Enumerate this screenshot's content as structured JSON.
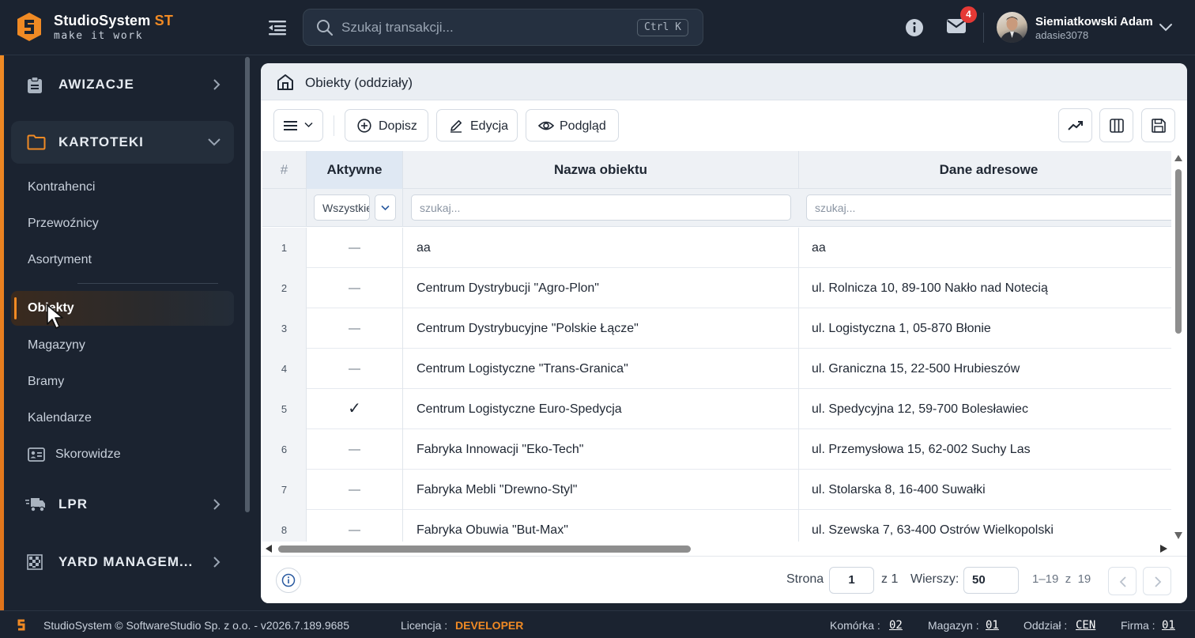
{
  "app": {
    "name": "StudioSystem",
    "name_suffix": "ST",
    "tagline": "make it work",
    "brand_color": "#f08a24"
  },
  "header": {
    "search_placeholder": "Szukaj transakcji...",
    "search_shortcut": "Ctrl K",
    "notifications_count": "4",
    "user_name": "Siemiatkowski Adam",
    "user_login": "adasie3078"
  },
  "sidebar": {
    "sections": [
      {
        "label": "AWIZACJE",
        "icon": "clipboard-icon",
        "expanded": false
      },
      {
        "label": "KARTOTEKI",
        "icon": "folder-icon",
        "expanded": true
      },
      {
        "label": "LPR",
        "icon": "truck-icon",
        "expanded": false
      },
      {
        "label": "YARD MANAGEM...",
        "icon": "grid-pattern-icon",
        "expanded": false
      }
    ],
    "items": [
      "Kontrahenci",
      "Przewoźnicy",
      "Asortyment",
      "Obiekty",
      "Magazyny",
      "Bramy",
      "Kalendarze",
      "Skorowidze"
    ],
    "active_item": "Obiekty"
  },
  "page": {
    "title": "Obiekty (oddziały)"
  },
  "toolbar": {
    "add_label": "Dopisz",
    "edit_label": "Edycja",
    "preview_label": "Podgląd"
  },
  "grid": {
    "col_index": "#",
    "col_active": "Aktywne",
    "col_name": "Nazwa obiektu",
    "col_address": "Dane adresowe",
    "filter_active_value": "Wszystkie",
    "filter_placeholder": "szukaj...",
    "rows": [
      {
        "n": "1",
        "active": "—",
        "name": "aa",
        "address": "aa"
      },
      {
        "n": "2",
        "active": "—",
        "name": "Centrum Dystrybucji \"Agro-Plon\"",
        "address": "ul. Rolnicza 10, 89-100 Nakło nad Notecią"
      },
      {
        "n": "3",
        "active": "—",
        "name": "Centrum Dystrybucyjne \"Polskie Łącze\"",
        "address": "ul. Logistyczna 1, 05-870 Błonie"
      },
      {
        "n": "4",
        "active": "—",
        "name": "Centrum Logistyczne \"Trans-Granica\"",
        "address": "ul. Graniczna 15, 22-500 Hrubieszów"
      },
      {
        "n": "5",
        "active": "✓",
        "name": "Centrum Logistyczne Euro-Spedycja",
        "address": "ul. Spedycyjna 12, 59-700 Bolesławiec"
      },
      {
        "n": "6",
        "active": "—",
        "name": "Fabryka Innowacji \"Eko-Tech\"",
        "address": "ul. Przemysłowa 15, 62-002 Suchy Las"
      },
      {
        "n": "7",
        "active": "—",
        "name": "Fabryka Mebli \"Drewno-Styl\"",
        "address": "ul. Stolarska 8, 16-400 Suwałki"
      },
      {
        "n": "8",
        "active": "—",
        "name": "Fabryka Obuwia \"But-Max\"",
        "address": "ul. Szewska 7, 63-400 Ostrów Wielkopolski"
      }
    ]
  },
  "pagination": {
    "page_label": "Strona",
    "page_value": "1",
    "of_label": "z 1",
    "rows_label": "Wierszy:",
    "rows_value": "50",
    "range": "1–19",
    "range_of": "z",
    "total": "19"
  },
  "statusbar": {
    "copyright": "StudioSystem © SoftwareStudio Sp. z o.o. - v2026.7.189.9685",
    "license_label": "Licencja :",
    "license_value": "DEVELOPER",
    "cell_label": "Komórka :",
    "cell_value": "02",
    "warehouse_label": "Magazyn :",
    "warehouse_value": "01",
    "branch_label": "Oddział :",
    "branch_value": "CEN",
    "company_label": "Firma :",
    "company_value": "01"
  }
}
